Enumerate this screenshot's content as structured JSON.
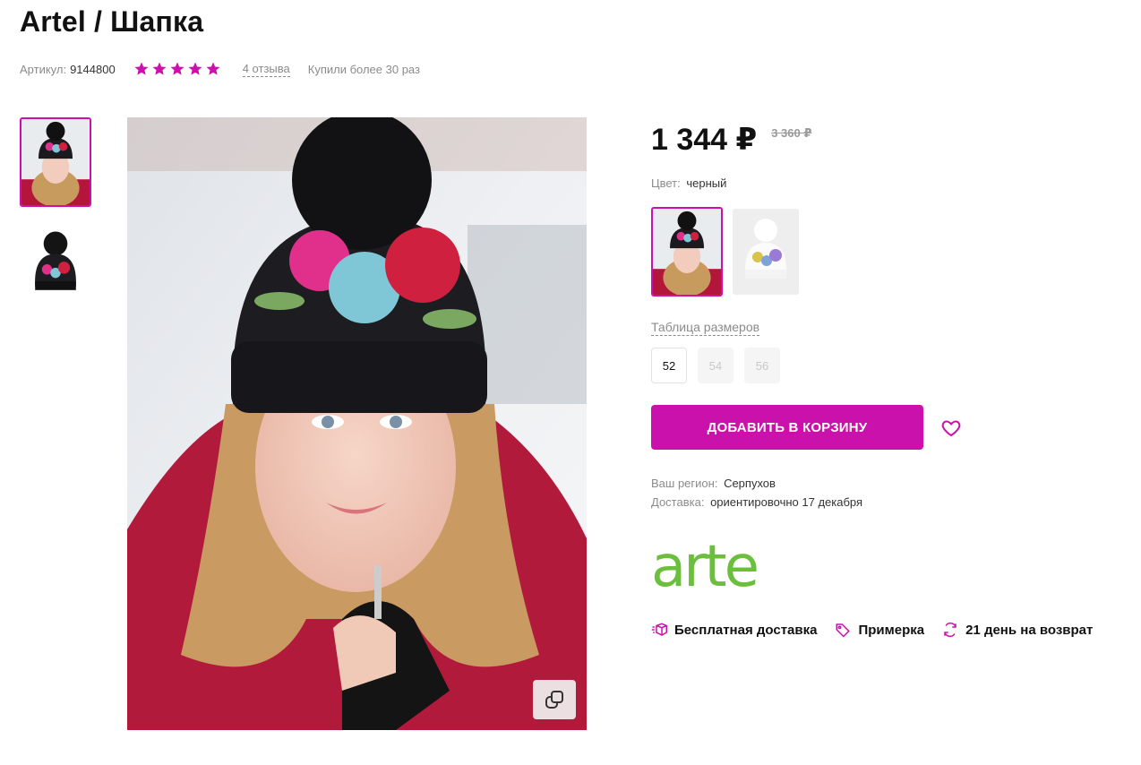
{
  "product": {
    "title": "Artel / Шапка",
    "sku_label": "Артикул:",
    "sku_value": "9144800",
    "rating_stars": 5,
    "reviews_label": "4 отзыва",
    "bought_label": "Купили более 30 раз"
  },
  "pricing": {
    "price": "1 344 ₽",
    "old_price": "3 360 ₽"
  },
  "color": {
    "label": "Цвет:",
    "value": "черный"
  },
  "sizes": {
    "table_label": "Таблица размеров",
    "options": [
      {
        "label": "52",
        "available": true
      },
      {
        "label": "54",
        "available": false
      },
      {
        "label": "56",
        "available": false
      }
    ]
  },
  "actions": {
    "add_to_cart": "ДОБАВИТЬ В КОРЗИНУ"
  },
  "delivery": {
    "region_label": "Ваш регион:",
    "region_value": "Серпухов",
    "delivery_label": "Доставка:",
    "delivery_value": "ориентировочно 17 декабря"
  },
  "brand": {
    "logo_text": "artel"
  },
  "features": [
    {
      "icon": "delivery-truck-icon",
      "label": "Бесплатная доставка"
    },
    {
      "icon": "tag-icon",
      "label": "Примерка"
    },
    {
      "icon": "refresh-icon",
      "label": "21 день на возврат"
    }
  ],
  "colors": {
    "accent": "#cb11ab",
    "brand_green": "#6cbf3d",
    "muted_text": "#8b8b8b"
  }
}
